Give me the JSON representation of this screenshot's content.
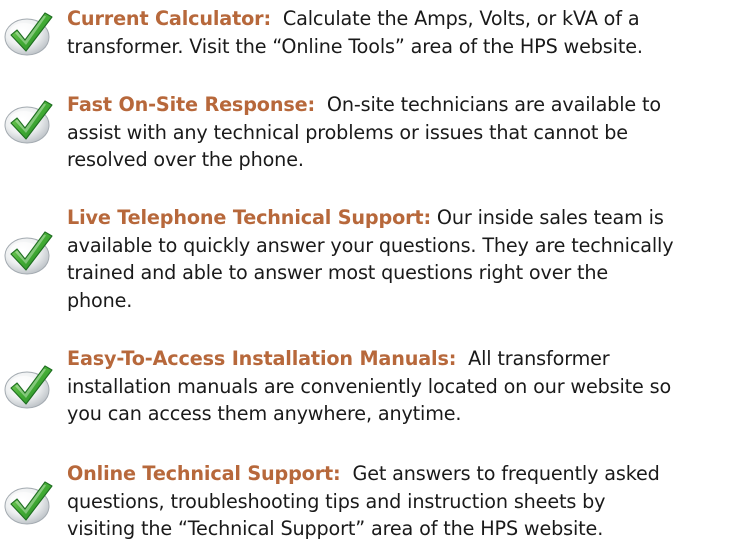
{
  "colors": {
    "title": "#b7683b",
    "body_text": "#1a1a1a",
    "check_green": "#3fa63a"
  },
  "icon": "green-checkmark-icon",
  "features": [
    {
      "title": "Current Calculator:",
      "lines": [
        "  Calculate the Amps, Volts, or kVA of a",
        "transformer.  Visit the “Online Tools” area of the HPS website."
      ]
    },
    {
      "title": "Fast On-Site Response:",
      "lines": [
        "  On-site technicians are available to",
        "assist with any technical problems or issues that cannot be",
        "resolved over the phone."
      ]
    },
    {
      "title": "Live Telephone Technical Support:",
      "lines": [
        " Our inside sales team is",
        "available to quickly answer your questions.  They are technically",
        "trained and able to answer most questions right over the",
        "phone."
      ]
    },
    {
      "title": "Easy-To-Access Installation Manuals:",
      "lines": [
        "  All transformer",
        "installation manuals are conveniently located on our website so",
        "you can access them anywhere, anytime."
      ]
    },
    {
      "title": "Online Technical Support:",
      "lines": [
        "  Get answers to frequently asked",
        "questions, troubleshooting tips and instruction sheets by",
        "visiting the “Technical Support” area of the HPS website."
      ]
    }
  ]
}
